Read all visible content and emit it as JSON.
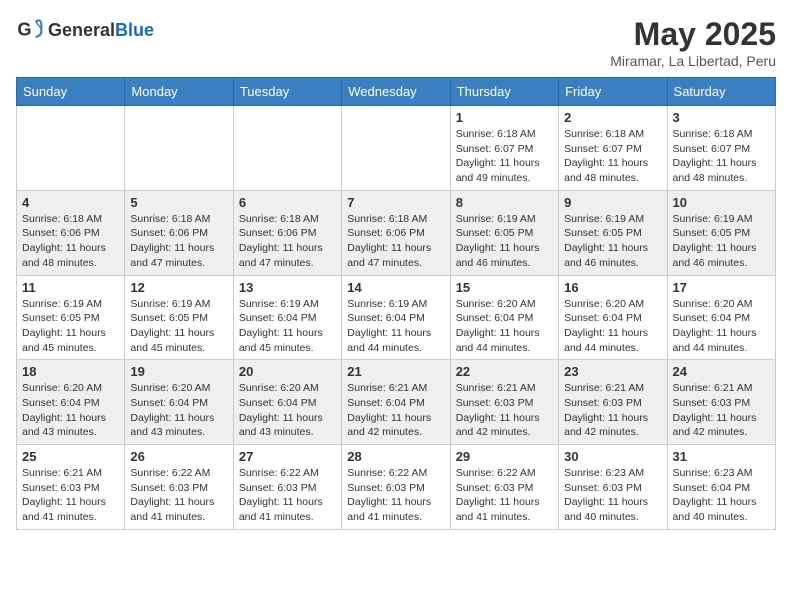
{
  "header": {
    "logo_general": "General",
    "logo_blue": "Blue",
    "title": "May 2025",
    "subtitle": "Miramar, La Libertad, Peru"
  },
  "weekdays": [
    "Sunday",
    "Monday",
    "Tuesday",
    "Wednesday",
    "Thursday",
    "Friday",
    "Saturday"
  ],
  "rows": [
    [
      {
        "day": "",
        "info": ""
      },
      {
        "day": "",
        "info": ""
      },
      {
        "day": "",
        "info": ""
      },
      {
        "day": "",
        "info": ""
      },
      {
        "day": "1",
        "info": "Sunrise: 6:18 AM\nSunset: 6:07 PM\nDaylight: 11 hours\nand 49 minutes."
      },
      {
        "day": "2",
        "info": "Sunrise: 6:18 AM\nSunset: 6:07 PM\nDaylight: 11 hours\nand 48 minutes."
      },
      {
        "day": "3",
        "info": "Sunrise: 6:18 AM\nSunset: 6:07 PM\nDaylight: 11 hours\nand 48 minutes."
      }
    ],
    [
      {
        "day": "4",
        "info": "Sunrise: 6:18 AM\nSunset: 6:06 PM\nDaylight: 11 hours\nand 48 minutes."
      },
      {
        "day": "5",
        "info": "Sunrise: 6:18 AM\nSunset: 6:06 PM\nDaylight: 11 hours\nand 47 minutes."
      },
      {
        "day": "6",
        "info": "Sunrise: 6:18 AM\nSunset: 6:06 PM\nDaylight: 11 hours\nand 47 minutes."
      },
      {
        "day": "7",
        "info": "Sunrise: 6:18 AM\nSunset: 6:06 PM\nDaylight: 11 hours\nand 47 minutes."
      },
      {
        "day": "8",
        "info": "Sunrise: 6:19 AM\nSunset: 6:05 PM\nDaylight: 11 hours\nand 46 minutes."
      },
      {
        "day": "9",
        "info": "Sunrise: 6:19 AM\nSunset: 6:05 PM\nDaylight: 11 hours\nand 46 minutes."
      },
      {
        "day": "10",
        "info": "Sunrise: 6:19 AM\nSunset: 6:05 PM\nDaylight: 11 hours\nand 46 minutes."
      }
    ],
    [
      {
        "day": "11",
        "info": "Sunrise: 6:19 AM\nSunset: 6:05 PM\nDaylight: 11 hours\nand 45 minutes."
      },
      {
        "day": "12",
        "info": "Sunrise: 6:19 AM\nSunset: 6:05 PM\nDaylight: 11 hours\nand 45 minutes."
      },
      {
        "day": "13",
        "info": "Sunrise: 6:19 AM\nSunset: 6:04 PM\nDaylight: 11 hours\nand 45 minutes."
      },
      {
        "day": "14",
        "info": "Sunrise: 6:19 AM\nSunset: 6:04 PM\nDaylight: 11 hours\nand 44 minutes."
      },
      {
        "day": "15",
        "info": "Sunrise: 6:20 AM\nSunset: 6:04 PM\nDaylight: 11 hours\nand 44 minutes."
      },
      {
        "day": "16",
        "info": "Sunrise: 6:20 AM\nSunset: 6:04 PM\nDaylight: 11 hours\nand 44 minutes."
      },
      {
        "day": "17",
        "info": "Sunrise: 6:20 AM\nSunset: 6:04 PM\nDaylight: 11 hours\nand 44 minutes."
      }
    ],
    [
      {
        "day": "18",
        "info": "Sunrise: 6:20 AM\nSunset: 6:04 PM\nDaylight: 11 hours\nand 43 minutes."
      },
      {
        "day": "19",
        "info": "Sunrise: 6:20 AM\nSunset: 6:04 PM\nDaylight: 11 hours\nand 43 minutes."
      },
      {
        "day": "20",
        "info": "Sunrise: 6:20 AM\nSunset: 6:04 PM\nDaylight: 11 hours\nand 43 minutes."
      },
      {
        "day": "21",
        "info": "Sunrise: 6:21 AM\nSunset: 6:04 PM\nDaylight: 11 hours\nand 42 minutes."
      },
      {
        "day": "22",
        "info": "Sunrise: 6:21 AM\nSunset: 6:03 PM\nDaylight: 11 hours\nand 42 minutes."
      },
      {
        "day": "23",
        "info": "Sunrise: 6:21 AM\nSunset: 6:03 PM\nDaylight: 11 hours\nand 42 minutes."
      },
      {
        "day": "24",
        "info": "Sunrise: 6:21 AM\nSunset: 6:03 PM\nDaylight: 11 hours\nand 42 minutes."
      }
    ],
    [
      {
        "day": "25",
        "info": "Sunrise: 6:21 AM\nSunset: 6:03 PM\nDaylight: 11 hours\nand 41 minutes."
      },
      {
        "day": "26",
        "info": "Sunrise: 6:22 AM\nSunset: 6:03 PM\nDaylight: 11 hours\nand 41 minutes."
      },
      {
        "day": "27",
        "info": "Sunrise: 6:22 AM\nSunset: 6:03 PM\nDaylight: 11 hours\nand 41 minutes."
      },
      {
        "day": "28",
        "info": "Sunrise: 6:22 AM\nSunset: 6:03 PM\nDaylight: 11 hours\nand 41 minutes."
      },
      {
        "day": "29",
        "info": "Sunrise: 6:22 AM\nSunset: 6:03 PM\nDaylight: 11 hours\nand 41 minutes."
      },
      {
        "day": "30",
        "info": "Sunrise: 6:23 AM\nSunset: 6:03 PM\nDaylight: 11 hours\nand 40 minutes."
      },
      {
        "day": "31",
        "info": "Sunrise: 6:23 AM\nSunset: 6:04 PM\nDaylight: 11 hours\nand 40 minutes."
      }
    ]
  ]
}
